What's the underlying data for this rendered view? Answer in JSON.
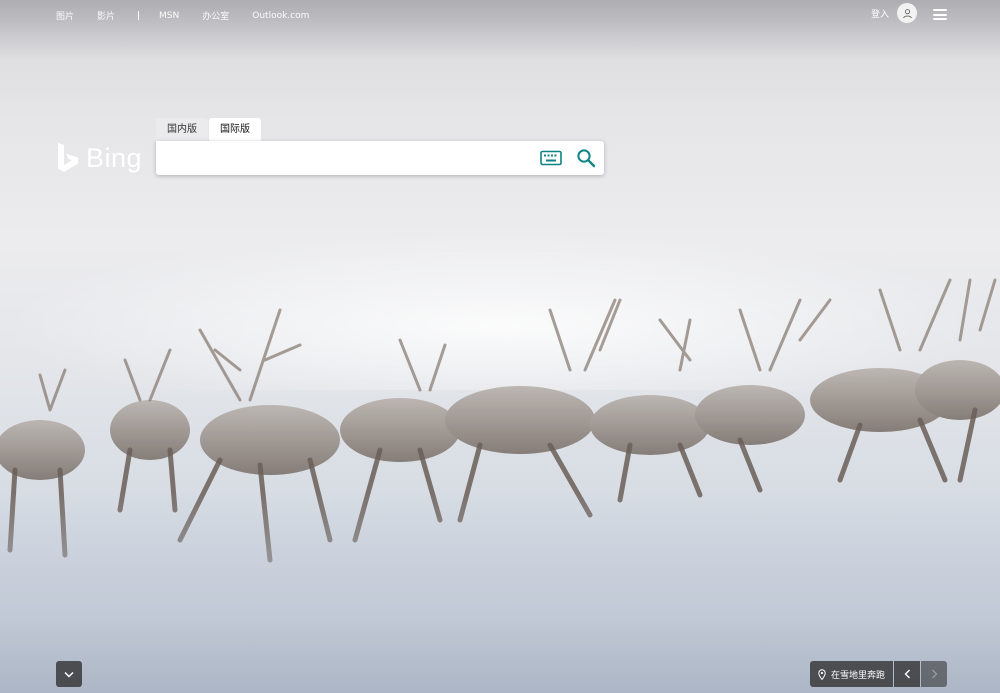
{
  "nav": {
    "links": [
      "图片",
      "影片",
      "MSN",
      "办公室",
      "Outlook.com"
    ],
    "signin_label": "登入"
  },
  "logo": {
    "text": "Bing"
  },
  "search": {
    "tabs": [
      "国内版",
      "国际版"
    ],
    "active_tab": "国际版",
    "value": "",
    "placeholder": ""
  },
  "image_caption": {
    "text": "在雪地里奔跑"
  },
  "icons": {
    "avatar": "person-icon",
    "menu": "hamburger-menu-icon",
    "keyboard": "keyboard-icon",
    "search": "search-icon",
    "scroll_down": "chevron-down-icon",
    "location": "location-pin-icon",
    "prev": "chevron-left-icon",
    "next": "chevron-right-icon"
  },
  "colors": {
    "accent": "#0c8484",
    "control_bg": "#282828"
  }
}
